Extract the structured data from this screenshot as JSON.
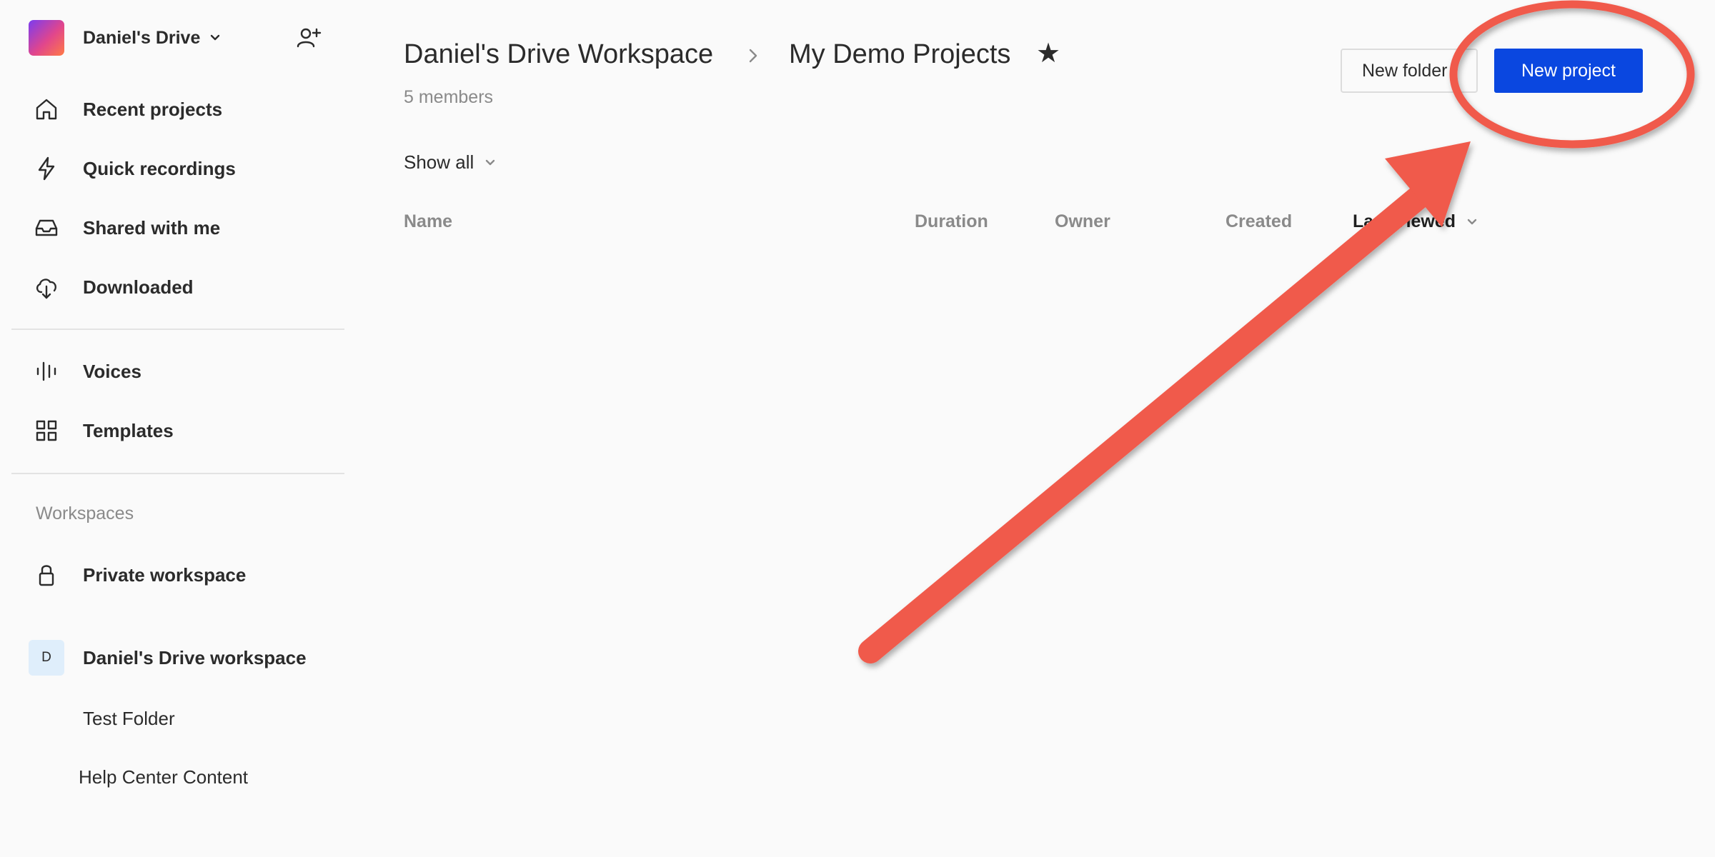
{
  "sidebar": {
    "account_name": "Daniel's Drive",
    "nav": [
      {
        "label": "Recent projects",
        "icon": "home-icon"
      },
      {
        "label": "Quick recordings",
        "icon": "lightning-icon"
      },
      {
        "label": "Shared with me",
        "icon": "inbox-icon"
      },
      {
        "label": "Downloaded",
        "icon": "cloud-download-icon"
      }
    ],
    "tools": [
      {
        "label": "Voices",
        "icon": "voice-bars-icon"
      },
      {
        "label": "Templates",
        "icon": "grid-icon"
      }
    ],
    "workspaces_header": "Workspaces",
    "private_workspace": "Private workspace",
    "workspace": {
      "badge": "D",
      "label": "Daniel's Drive workspace"
    },
    "folders": [
      "Test Folder",
      "Help Center Content"
    ]
  },
  "header": {
    "breadcrumb_root": "Daniel's Drive Workspace",
    "title": "My Demo Projects",
    "star": "★",
    "members": "5 members"
  },
  "actions": {
    "new_folder": "New folder",
    "new_project": "New project"
  },
  "filter": {
    "label": "Show all"
  },
  "table": {
    "columns": [
      "Name",
      "Duration",
      "Owner",
      "Created",
      "Last Viewed"
    ]
  },
  "colors": {
    "primary": "#0a47e0",
    "annotation": "#f05a4b"
  }
}
